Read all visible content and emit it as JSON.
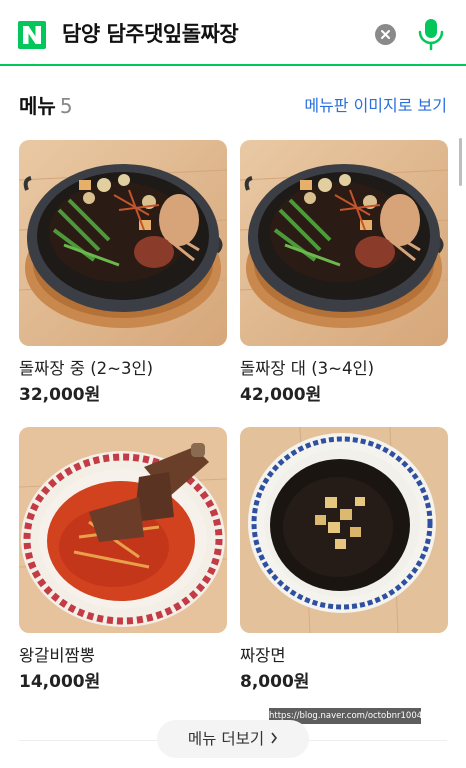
{
  "search": {
    "logo_letter": "N",
    "query": "담양 담주댓잎돌짜장",
    "brand_color": "#03c75a",
    "clear_icon": "clear-icon",
    "mic_icon": "microphone-icon"
  },
  "menu_section": {
    "title": "메뉴",
    "count": "5",
    "menu_image_link": "메뉴판 이미지로 보기",
    "link_color": "#2a6fdb"
  },
  "menu_items": [
    {
      "name": "돌짜장 중 (2~3인)",
      "price": "32,000원"
    },
    {
      "name": "돌짜장 대 (3~4인)",
      "price": "42,000원"
    },
    {
      "name": "왕갈비짬뽕",
      "price": "14,000원"
    },
    {
      "name": "짜장면",
      "price": "8,000원"
    }
  ],
  "more_button": {
    "label": "메뉴 더보기"
  },
  "watermark": "https://blog.naver.com/octobnr1004"
}
